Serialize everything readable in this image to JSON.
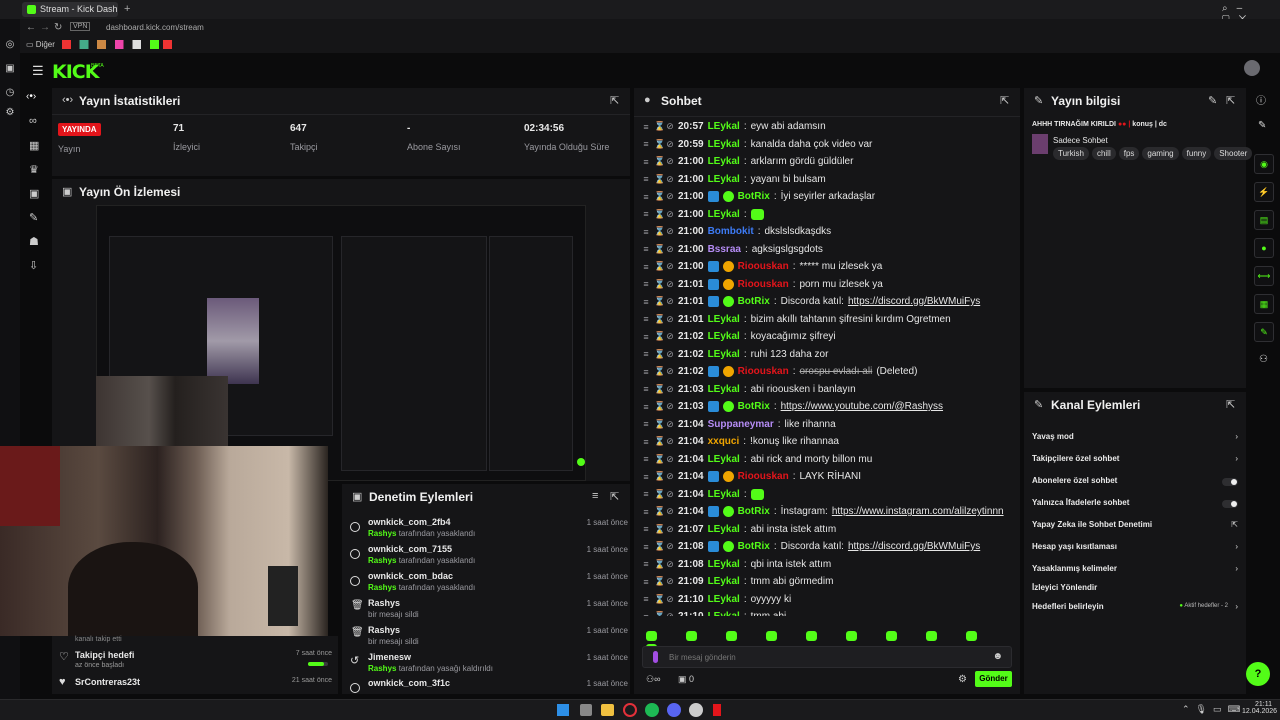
{
  "browser": {
    "tab_title": "Stream - Kick Dashbo",
    "url": "dashboard.kick.com/stream",
    "vpn": "VPN",
    "bookmark_folder": "Diğer"
  },
  "header": {
    "logo": "KICK",
    "beta": "BETA"
  },
  "stats": {
    "title": "Yayın İstatistikleri",
    "live_badge": "YAYINDA",
    "items": [
      {
        "value": "",
        "label": "Yayın"
      },
      {
        "value": "71",
        "label": "İzleyici"
      },
      {
        "value": "647",
        "label": "Takipçi"
      },
      {
        "value": "-",
        "label": "Abone Sayısı"
      },
      {
        "value": "02:34:56",
        "label": "Yayında Olduğu Süre"
      }
    ]
  },
  "preview": {
    "title": "Yayın Ön İzlemesi"
  },
  "moderation": {
    "title": "Denetim Eylemleri",
    "rows": [
      {
        "user": "ownkick_com_2fb4",
        "actor": "Rashys",
        "action": "tarafından yasaklandı",
        "time": "1 saat önce"
      },
      {
        "user": "ownkick_com_7155",
        "actor": "Rashys",
        "action": "tarafından yasaklandı",
        "time": "1 saat önce"
      },
      {
        "user": "ownkick_com_bdac",
        "actor": "Rashys",
        "action": "tarafından yasaklandı",
        "time": "1 saat önce"
      },
      {
        "user": "Rashys",
        "actor": "",
        "action": "bir mesajı sildi",
        "time": "1 saat önce"
      },
      {
        "user": "Rashys",
        "actor": "",
        "action": "bir mesajı sildi",
        "time": "1 saat önce"
      },
      {
        "user": "Jimenesw",
        "actor": "Rashys",
        "action": "tarafından yasağı kaldırıldı",
        "time": "1 saat önce"
      },
      {
        "user": "ownkick_com_3f1c",
        "actor": "",
        "action": "",
        "time": "1 saat önce"
      }
    ]
  },
  "goals": {
    "partial_label": "kanalı takip etti",
    "goal_label": "Takipçi hedefi",
    "goal_sub": "az önce başladı",
    "goal_time": "7 saat önce",
    "follower": "SrContreras23t",
    "follower_time": "21 saat önce"
  },
  "chat": {
    "title": "Sohbet",
    "input_placeholder": "Bir mesaj gönderin",
    "send_label": "Gönder",
    "count": "0",
    "messages": [
      {
        "time": "20:57",
        "user": "LEykal",
        "color": "#53fc18",
        "badges": [],
        "text": "eyw abi adamsın"
      },
      {
        "time": "20:59",
        "user": "LEykal",
        "color": "#53fc18",
        "badges": [],
        "text": "kanalda daha çok video var"
      },
      {
        "time": "21:00",
        "user": "LEykal",
        "color": "#53fc18",
        "badges": [],
        "text": "arklarım gördü güldüler"
      },
      {
        "time": "21:00",
        "user": "LEykal",
        "color": "#53fc18",
        "badges": [],
        "text": "yayanı bi bulsam"
      },
      {
        "time": "21:00",
        "user": "BotRix",
        "color": "#53fc18",
        "badges": [
          "v",
          "c"
        ],
        "text": "İyi seyirler arkadaşlar"
      },
      {
        "time": "21:00",
        "user": "LEykal",
        "color": "#53fc18",
        "badges": [],
        "text": "",
        "emote": true
      },
      {
        "time": "21:00",
        "user": "Bombokit",
        "color": "#3d7bf5",
        "badges": [],
        "text": "dkslslsdkaşdks"
      },
      {
        "time": "21:00",
        "user": "Bssraa",
        "color": "#b58cf5",
        "badges": [],
        "text": "agksigslgsgdots"
      },
      {
        "time": "21:00",
        "user": "Rioouskan",
        "color": "#e3151b",
        "badges": [
          "v",
          "s"
        ],
        "text": "***** mu izlesek ya"
      },
      {
        "time": "21:01",
        "user": "Rioouskan",
        "color": "#e3151b",
        "badges": [
          "v",
          "s"
        ],
        "text": "porn mu izlesek ya"
      },
      {
        "time": "21:01",
        "user": "BotRix",
        "color": "#53fc18",
        "badges": [
          "v",
          "c"
        ],
        "text": "Discorda katıl: ",
        "link": "https://discord.gg/BkWMuiFys"
      },
      {
        "time": "21:01",
        "user": "LEykal",
        "color": "#53fc18",
        "badges": [],
        "text": "bizim akıllı tahtanın şifresini kırdım Ogretmen"
      },
      {
        "time": "21:02",
        "user": "LEykal",
        "color": "#53fc18",
        "badges": [],
        "text": "koyacağımız şifreyi"
      },
      {
        "time": "21:02",
        "user": "LEykal",
        "color": "#53fc18",
        "badges": [],
        "text": "ruhi 123 daha zor"
      },
      {
        "time": "21:02",
        "user": "Rioouskan",
        "color": "#e3151b",
        "badges": [
          "v",
          "s"
        ],
        "deleted": "orospu evladı ali",
        "text": " (Deleted)"
      },
      {
        "time": "21:03",
        "user": "LEykal",
        "color": "#53fc18",
        "badges": [],
        "text": "abi rioousken i banlayın"
      },
      {
        "time": "21:03",
        "user": "BotRix",
        "color": "#53fc18",
        "badges": [
          "v",
          "c"
        ],
        "text": "",
        "link": "https://www.youtube.com/@Rashyss"
      },
      {
        "time": "21:04",
        "user": "Suppaneymar",
        "color": "#b58cf5",
        "badges": [],
        "text": "like rihanna"
      },
      {
        "time": "21:04",
        "user": "xxquci",
        "color": "#f0a500",
        "badges": [],
        "text": "!konuş like rihannaa"
      },
      {
        "time": "21:04",
        "user": "LEykal",
        "color": "#53fc18",
        "badges": [],
        "text": "abi rick and morty billon mu"
      },
      {
        "time": "21:04",
        "user": "Rioouskan",
        "color": "#e3151b",
        "badges": [
          "v",
          "s"
        ],
        "text": "LAYK RİHANI"
      },
      {
        "time": "21:04",
        "user": "LEykal",
        "color": "#53fc18",
        "badges": [],
        "text": "",
        "emote": true
      },
      {
        "time": "21:04",
        "user": "BotRix",
        "color": "#53fc18",
        "badges": [
          "v",
          "c"
        ],
        "text": "İnstagram: ",
        "link": "https://www.instagram.com/alilzeytinnn"
      },
      {
        "time": "21:07",
        "user": "LEykal",
        "color": "#53fc18",
        "badges": [],
        "text": "abi insta istek attım"
      },
      {
        "time": "21:08",
        "user": "BotRix",
        "color": "#53fc18",
        "badges": [
          "v",
          "c"
        ],
        "text": "Discorda katıl: ",
        "link": "https://discord.gg/BkWMuiFys"
      },
      {
        "time": "21:08",
        "user": "LEykal",
        "color": "#53fc18",
        "badges": [],
        "text": "qbi inta istek attım"
      },
      {
        "time": "21:09",
        "user": "LEykal",
        "color": "#53fc18",
        "badges": [],
        "text": "tmm abi görmedim"
      },
      {
        "time": "21:10",
        "user": "LEykal",
        "color": "#53fc18",
        "badges": [],
        "text": "oyyyyy ki"
      },
      {
        "time": "21:10",
        "user": "LEykal",
        "color": "#53fc18",
        "badges": [],
        "text": "tmm abi"
      }
    ]
  },
  "stream_info": {
    "title": "Yayın bilgisi",
    "stream_title": "AHHH TIRNAĞIM KIRILDI",
    "commands": "konuş | dc",
    "category": "Sadece Sohbet",
    "tags": [
      "Turkish",
      "chill",
      "fps",
      "gaming",
      "funny",
      "Shooter"
    ]
  },
  "channel_actions": {
    "title": "Kanal Eylemleri",
    "items": [
      {
        "label": "Yavaş mod",
        "control": "chevron"
      },
      {
        "label": "Takipçilere özel sohbet",
        "control": "chevron"
      },
      {
        "label": "Abonelere özel sohbet",
        "control": "toggle"
      },
      {
        "label": "Yalnızca İfadelerle sohbet",
        "control": "toggle"
      },
      {
        "label": "Yapay Zeka ile Sohbet Denetimi",
        "control": "external"
      },
      {
        "label": "Hesap yaşı kısıtlaması",
        "control": "chevron"
      },
      {
        "label": "Yasaklanmış kelimeler",
        "control": "chevron"
      },
      {
        "label": "İzleyici Yönlendir",
        "control": "none"
      },
      {
        "label": "Hedefleri belirleyin",
        "control": "chevron",
        "extra": "Aktif hedefler - 2"
      }
    ]
  },
  "clock": {
    "time": "21:11",
    "date": "12.04.2026"
  }
}
